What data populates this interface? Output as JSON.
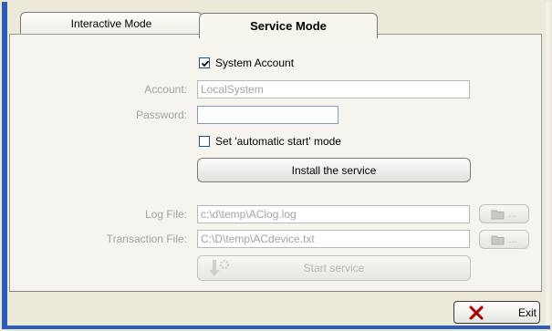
{
  "tabs": [
    {
      "label": "Interactive Mode",
      "active": false
    },
    {
      "label": "Service Mode",
      "active": true
    }
  ],
  "service": {
    "system_account": {
      "label": "System Account",
      "checked": true
    },
    "account": {
      "label": "Account:",
      "value": "LocalSystem"
    },
    "password": {
      "label": "Password:",
      "value": ""
    },
    "auto_start": {
      "label": "Set 'automatic start' mode",
      "checked": false
    },
    "install_button": "Install the service",
    "log_file": {
      "label": "Log File:",
      "value": "c:\\d\\temp\\AClog.log"
    },
    "transaction_file": {
      "label": "Transaction File:",
      "value": "C:\\D\\temp\\ACdevice.txt"
    },
    "browse_label": "...",
    "start_button": "Start service"
  },
  "footer": {
    "exit_label": "Exit"
  },
  "icons": {
    "check": "checkmark-icon",
    "folder": "folder-icon",
    "start": "start-service-icon",
    "exit": "exit-icon"
  },
  "colors": {
    "window_frame": "#2b5eb8",
    "disabled_text": "#a3a3a3",
    "exit_icon": "#c40000"
  }
}
